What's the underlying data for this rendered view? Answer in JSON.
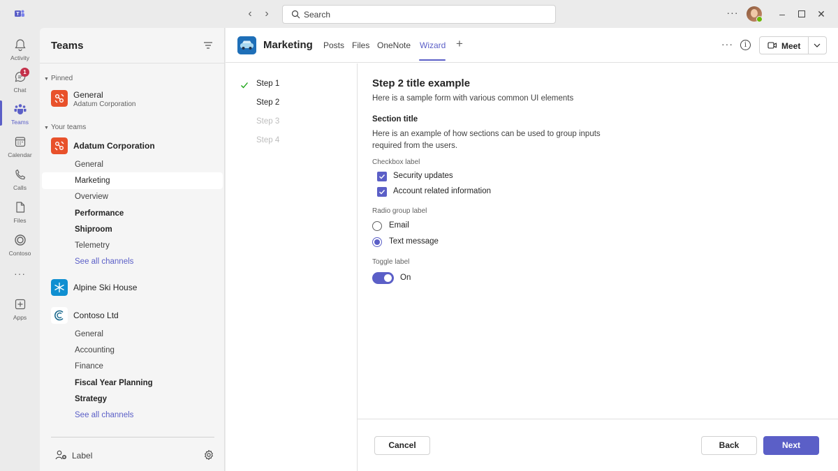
{
  "app": {
    "search_placeholder": "Search"
  },
  "rail": {
    "items": [
      {
        "label": "Activity",
        "icon": "bell-icon"
      },
      {
        "label": "Chat",
        "icon": "chat-icon",
        "badge": "1"
      },
      {
        "label": "Teams",
        "icon": "teams-icon",
        "active": true
      },
      {
        "label": "Calendar",
        "icon": "calendar-icon"
      },
      {
        "label": "Calls",
        "icon": "phone-icon"
      },
      {
        "label": "Files",
        "icon": "file-icon"
      },
      {
        "label": "Contoso",
        "icon": "contoso-icon"
      },
      {
        "label": "Apps",
        "icon": "add-app-icon"
      }
    ]
  },
  "left_panel": {
    "title": "Teams",
    "pinned_label": "Pinned",
    "pinned": {
      "name": "General",
      "subtitle": "Adatum Corporation"
    },
    "your_teams_label": "Your teams",
    "teams": [
      {
        "name": "Adatum Corporation",
        "channels": [
          "General",
          "Marketing",
          "Overview",
          "Performance",
          "Shiproom",
          "Telemetry",
          "See all channels"
        ]
      },
      {
        "name": "Alpine Ski House",
        "channels": []
      },
      {
        "name": "Contoso Ltd",
        "channels": [
          "General",
          "Accounting",
          "Finance",
          "Fiscal Year Planning",
          "Strategy",
          "See all channels"
        ]
      }
    ],
    "bottom_label": "Label"
  },
  "header": {
    "channel_title": "Marketing",
    "tabs": [
      "Posts",
      "Files",
      "OneNote",
      "Wizard"
    ],
    "active_tab": "Wizard",
    "meet_label": "Meet"
  },
  "wizard": {
    "steps": [
      {
        "label": "Step 1",
        "state": "complete"
      },
      {
        "label": "Step 2",
        "state": "current"
      },
      {
        "label": "Step 3",
        "state": "disabled"
      },
      {
        "label": "Step 4",
        "state": "disabled"
      }
    ],
    "title": "Step 2 title example",
    "subtitle": "Here is a sample form with various common UI elements",
    "section_title": "Section title",
    "section_description": "Here is an example of how sections can be used to group inputs required from the users.",
    "checkbox_label": "Checkbox label",
    "checkboxes": [
      {
        "label": "Security updates",
        "checked": true
      },
      {
        "label": "Account related information",
        "checked": true
      }
    ],
    "radio_label": "Radio group label",
    "radios": [
      {
        "label": "Email",
        "selected": false
      },
      {
        "label": "Text message",
        "selected": true
      }
    ],
    "toggle_label": "Toggle label",
    "toggle_state": "On",
    "buttons": {
      "cancel": "Cancel",
      "back": "Back",
      "next": "Next"
    }
  },
  "colors": {
    "accent": "#5b5fc7",
    "badge": "#c4314b",
    "team_orange": "#e8512b",
    "presence": "#6bb700"
  }
}
